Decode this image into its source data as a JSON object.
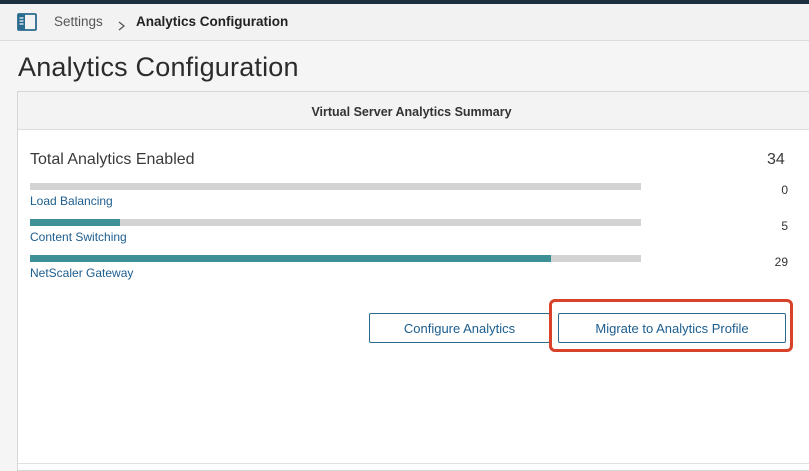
{
  "breadcrumb": {
    "parent": "Settings",
    "current": "Analytics Configuration"
  },
  "page": {
    "title": "Analytics Configuration"
  },
  "summary": {
    "title": "Virtual Server Analytics Summary",
    "total_label": "Total Analytics Enabled",
    "total_value": "34",
    "rows": [
      {
        "label": "Load Balancing",
        "value": "0",
        "fill_fraction": 0.0
      },
      {
        "label": "Content Switching",
        "value": "5",
        "fill_fraction": 0.147
      },
      {
        "label": "NetScaler Gateway",
        "value": "29",
        "fill_fraction": 0.853
      }
    ]
  },
  "actions": {
    "configure_label": "Configure Analytics",
    "migrate_label": "Migrate to Analytics Profile"
  },
  "colors": {
    "bar_fill": "#3d9096",
    "bar_track": "#d3d3d3",
    "link": "#1c5d8e",
    "highlight": "#d8412a"
  }
}
